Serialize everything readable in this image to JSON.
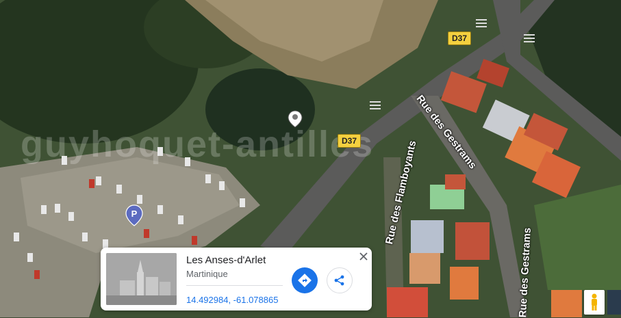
{
  "map": {
    "road_labels": [
      "D37",
      "D37"
    ],
    "streets": [
      "Rue des Gestrams",
      "Rue des Flamboyants",
      "Rue des Gestrams"
    ],
    "watermark": "guyhoquet-antilles",
    "parking_marker": "P"
  },
  "place_card": {
    "title": "Les Anses-d'Arlet",
    "subtitle": "Martinique",
    "coordinates": "14.492984, -61.078865",
    "directions_icon": "directions-icon",
    "share_icon": "share-icon",
    "close_icon": "close-icon"
  },
  "controls": {
    "pegman_icon": "pegman-icon",
    "colors": {
      "accent": "#1a73e8",
      "road_label": "#f4d03f"
    }
  }
}
